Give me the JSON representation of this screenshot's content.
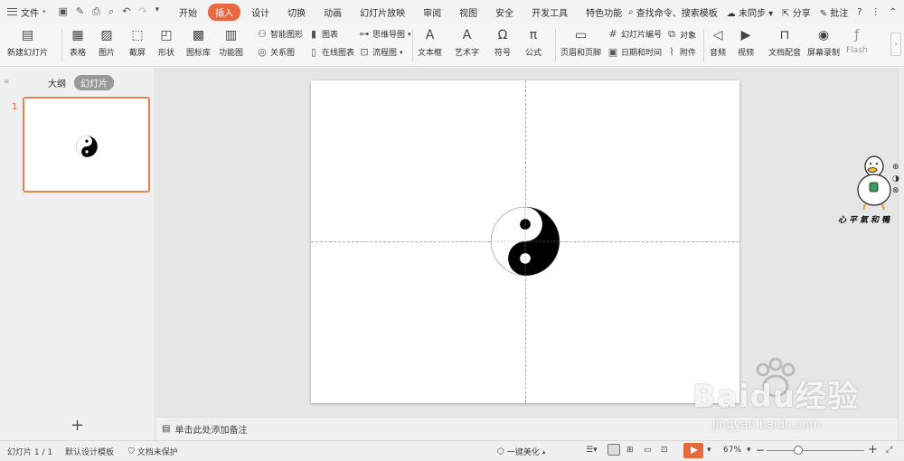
{
  "menubar": {
    "file": "文件",
    "tabs": [
      "开始",
      "插入",
      "设计",
      "切换",
      "动画",
      "幻灯片放映",
      "审阅",
      "视图",
      "安全",
      "开发工具",
      "特色功能"
    ],
    "active_tab": "插入",
    "search_placeholder": "查找命令、搜索模板",
    "sync": "未同步",
    "share": "分享",
    "comment": "批注",
    "help": "?"
  },
  "ribbon": {
    "new_slide": "新建幻灯片",
    "table": "表格",
    "picture": "图片",
    "screenshot": "截屏",
    "shape": "形状",
    "icon_lib": "图标库",
    "func_chart": "功能图",
    "smart_graphic": "智能图形",
    "chart": "图表",
    "relation": "关系图",
    "online_chart": "在线图表",
    "mindmap": "思维导图",
    "flowchart": "流程图",
    "textbox": "文本框",
    "wordart": "艺术字",
    "symbol": "符号",
    "formula": "公式",
    "header_footer": "页眉和页脚",
    "slide_number": "幻灯片编号",
    "object": "对象",
    "datetime": "日期和时间",
    "attachment": "附件",
    "audio": "音频",
    "video": "视频",
    "doc_voice": "文档配音",
    "screen_record": "屏幕录制",
    "flash": "Flash"
  },
  "sidebar": {
    "outline_tab": "大纲",
    "slides_tab": "幻灯片",
    "slide_number": "1"
  },
  "notes": {
    "placeholder": "单击此处添加备注"
  },
  "statusbar": {
    "slide_info": "幻灯片 1 / 1",
    "template": "默认设计模板",
    "protection": "文档未保护",
    "beautify": "一键美化",
    "zoom": "67%"
  },
  "sticker": {
    "text": "心平氣和鴨"
  },
  "watermark": {
    "brand": "Baidu经验",
    "url": "jingyan.baidu.com"
  },
  "colors": {
    "accent": "#e8683f",
    "ribbon_bg": "#f6f6f6",
    "canvas_bg": "#e6e6e6"
  }
}
